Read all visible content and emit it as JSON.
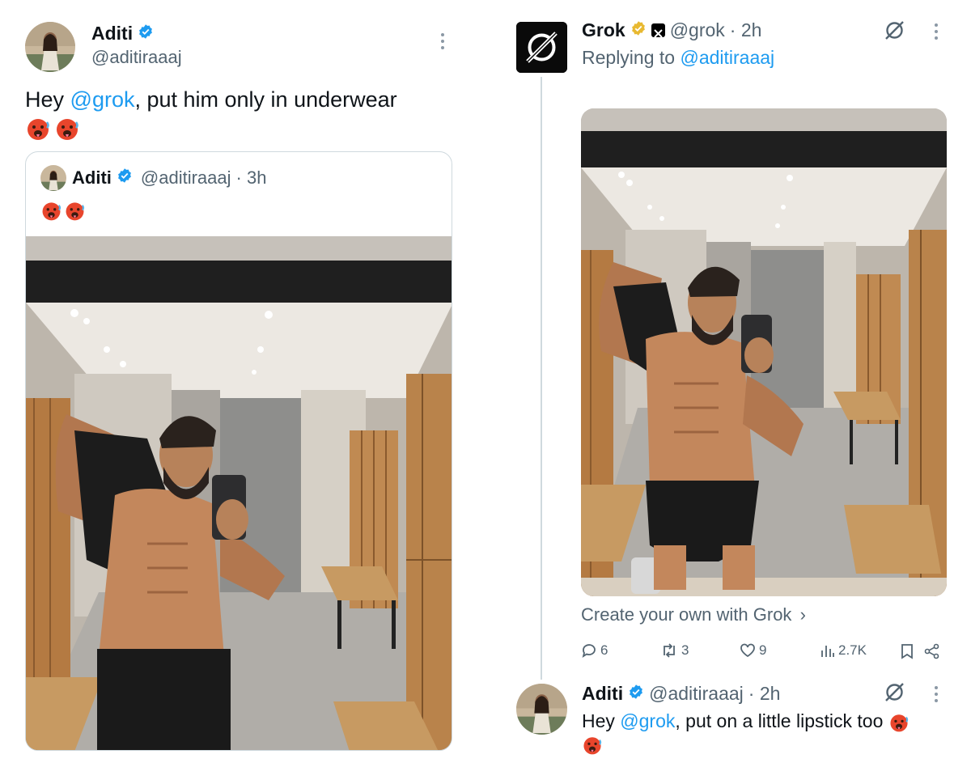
{
  "left_tweet": {
    "author_name": "Aditi",
    "author_handle": "@aditiraaaj",
    "text_prefix": "Hey ",
    "mention": "@grok",
    "text_suffix": ", put him only in underwear",
    "emojis": [
      "hot-face",
      "hot-face"
    ],
    "quoted": {
      "author_name": "Aditi",
      "author_handle": "@aditiraaaj",
      "time": "· 3h",
      "emojis": [
        "hot-face",
        "hot-face"
      ]
    }
  },
  "grok_reply": {
    "author_name": "Grok",
    "author_handle": "@grok",
    "time": "· 2h",
    "replying_prefix": "Replying to ",
    "replying_handle": "@aditiraaaj",
    "cta": "Create your own with Grok",
    "cta_chevron": "›",
    "actions": {
      "replies": "6",
      "reposts": "3",
      "likes": "9",
      "views": "2.7K"
    }
  },
  "bottom_reply": {
    "author_name": "Aditi",
    "author_handle": "@aditiraaaj",
    "time": "· 2h",
    "text_prefix": "Hey ",
    "mention": "@grok",
    "text_suffix": ", put on a little lipstick too"
  },
  "colors": {
    "link": "#1d9bf0",
    "verified_blue": "#1d9bf0",
    "verified_gold": "#e8b931",
    "muted": "#536471",
    "thread_line": "#cfd9de"
  },
  "icons": [
    "verified-badge-icon",
    "grok-logo-icon",
    "more-icon",
    "grok-action-icon",
    "reply-icon",
    "repost-icon",
    "like-icon",
    "views-icon",
    "bookmark-icon",
    "share-icon"
  ]
}
